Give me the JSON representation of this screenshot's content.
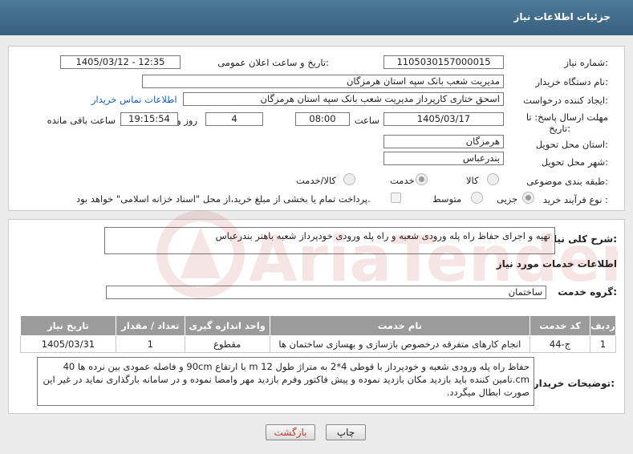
{
  "header": {
    "title": "جزئیات اطلاعات نیاز"
  },
  "form": {
    "need_number_label": "شماره نیاز:",
    "need_number": "1105030157000015",
    "announce_label": "تاریخ و ساعت اعلان عمومی:",
    "announce_value": "1405/03/12 - 12:35",
    "buyer_org_label": "نام دستگاه خریدار:",
    "buyer_org": "مدیریت شعب بانک سپه استان هرمزگان",
    "creator_label": "ایجاد کننده درخواست:",
    "creator": "اسحق ختاری کارپرداز مدیریت شعب بانک سپه استان هرمزگان",
    "contact_link": "اطلاعات تماس خریدار",
    "deadline_label_1": "مهلت ارسال پاسخ: تا",
    "deadline_label_2": "تاریخ:",
    "deadline_date": "1405/03/17",
    "time_label": "ساعت",
    "deadline_time": "08:00",
    "days_value": "4",
    "days_label": "روز و",
    "remaining_time": "19:15:54",
    "remaining_label": "ساعت باقی مانده",
    "province_label": "استان محل تحویل:",
    "province": "هرمزگان",
    "city_label": "شهر محل تحویل:",
    "city": "بندرعباس",
    "category_label": "طبقه بندی موضوعی:",
    "category_options": [
      "کالا",
      "خدمت",
      "کالا/خدمت"
    ],
    "category_selected": "خدمت",
    "process_label": "نوع فرآیند خرید :",
    "process_options": [
      "جزیی",
      "متوسط"
    ],
    "process_selected": "جزیی",
    "payment_note": "پرداخت تمام یا بخشی از مبلغ خرید،از محل \"اسناد خزانه اسلامی\" خواهد بود."
  },
  "summary": {
    "label": "شرح کلی نیاز:",
    "text": "تهیه و اجرای حفاظ راه پله ورودی شعبه و راه پله ورودی خودپرداز شعبه باهنر بندرعباس"
  },
  "services": {
    "section_title": "اطلاعات خدمات مورد نیاز",
    "group_label": "گروه خدمت:",
    "group_value": "ساختمان",
    "columns": [
      "ردیف",
      "کد خدمت",
      "نام خدمت",
      "واحد اندازه گیری",
      "تعداد / مقدار",
      "تاریخ نیاز"
    ],
    "rows": [
      [
        "1",
        "ج-44",
        "انجام کارهای متفرقه درخصوص بازسازی و بهسازی ساختمان ها",
        "مقطوع",
        "1",
        "1405/03/31"
      ]
    ]
  },
  "buyer_notes": {
    "label": "توضیحات خریدار:",
    "lines": [
      "حفاظ راه پله ورودی شعبه و خودپرداز با قوطی 4*2 به متراژ طول 12 m با ارتفاع 90cm و فاصله عمودی بین نرده ها 40",
      "cm.تامین کننده باید بازدید مکان بازدید نموده و پیش فاکتور وفرم بازدید مهر وامضا نموده و در سامانه بارگذاری نماید در غیر این",
      "صورت ابطال میگردد."
    ]
  },
  "buttons": {
    "print": "چاپ",
    "back": "بازگشت"
  },
  "watermark": {
    "text": "AriaTender.net"
  },
  "colors": {
    "header": "#3f6889",
    "table_head": "#9b9b9b",
    "back_button_text": "#c0392b",
    "link": "#1a5fb4"
  }
}
